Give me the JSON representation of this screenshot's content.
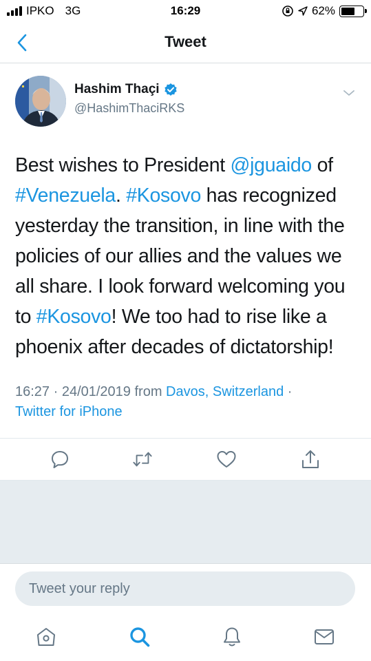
{
  "status_bar": {
    "carrier": "IPKO",
    "network": "3G",
    "time": "16:29",
    "battery": "62%",
    "battery_level": 0.62
  },
  "header": {
    "title": "Tweet",
    "back_icon": "chevron-left-icon"
  },
  "tweet": {
    "author_name": "Hashim Thaçi",
    "verified": true,
    "handle": "@HashimThaciRKS",
    "text_segments": [
      {
        "text": "Best wishes to President ",
        "link": false
      },
      {
        "text": "@jguaido",
        "link": true
      },
      {
        "text": " of ",
        "link": false
      },
      {
        "text": "#Venezuela",
        "link": true
      },
      {
        "text": ". ",
        "link": false
      },
      {
        "text": "#Kosovo",
        "link": true
      },
      {
        "text": " has recognized yesterday the transition, in line with the policies of our allies and the values we all share. I look forward welcoming you to ",
        "link": false
      },
      {
        "text": "#Kosovo",
        "link": true
      },
      {
        "text": "! We too had to rise like a phoenix after decades of dictatorship!",
        "link": false
      }
    ],
    "timestamp": "16:27 · 24/01/2019",
    "from_label": " from ",
    "location": "Davos, Switzerland",
    "separator": " ·",
    "source": "Twitter for iPhone"
  },
  "actions": [
    {
      "name": "reply",
      "icon": "reply-icon"
    },
    {
      "name": "retweet",
      "icon": "retweet-icon"
    },
    {
      "name": "like",
      "icon": "heart-icon"
    },
    {
      "name": "share",
      "icon": "share-icon"
    }
  ],
  "reply": {
    "placeholder": "Tweet your reply"
  },
  "tabs": [
    {
      "name": "home",
      "icon": "home-icon",
      "active": false
    },
    {
      "name": "search",
      "icon": "search-icon",
      "active": true
    },
    {
      "name": "notifications",
      "icon": "bell-icon",
      "active": false
    },
    {
      "name": "messages",
      "icon": "mail-icon",
      "active": false
    }
  ],
  "colors": {
    "accent": "#1b95e0",
    "text": "#14171a",
    "secondary": "#657786",
    "divider": "#e1e8ed",
    "gray_background": "#e6ecf0"
  }
}
